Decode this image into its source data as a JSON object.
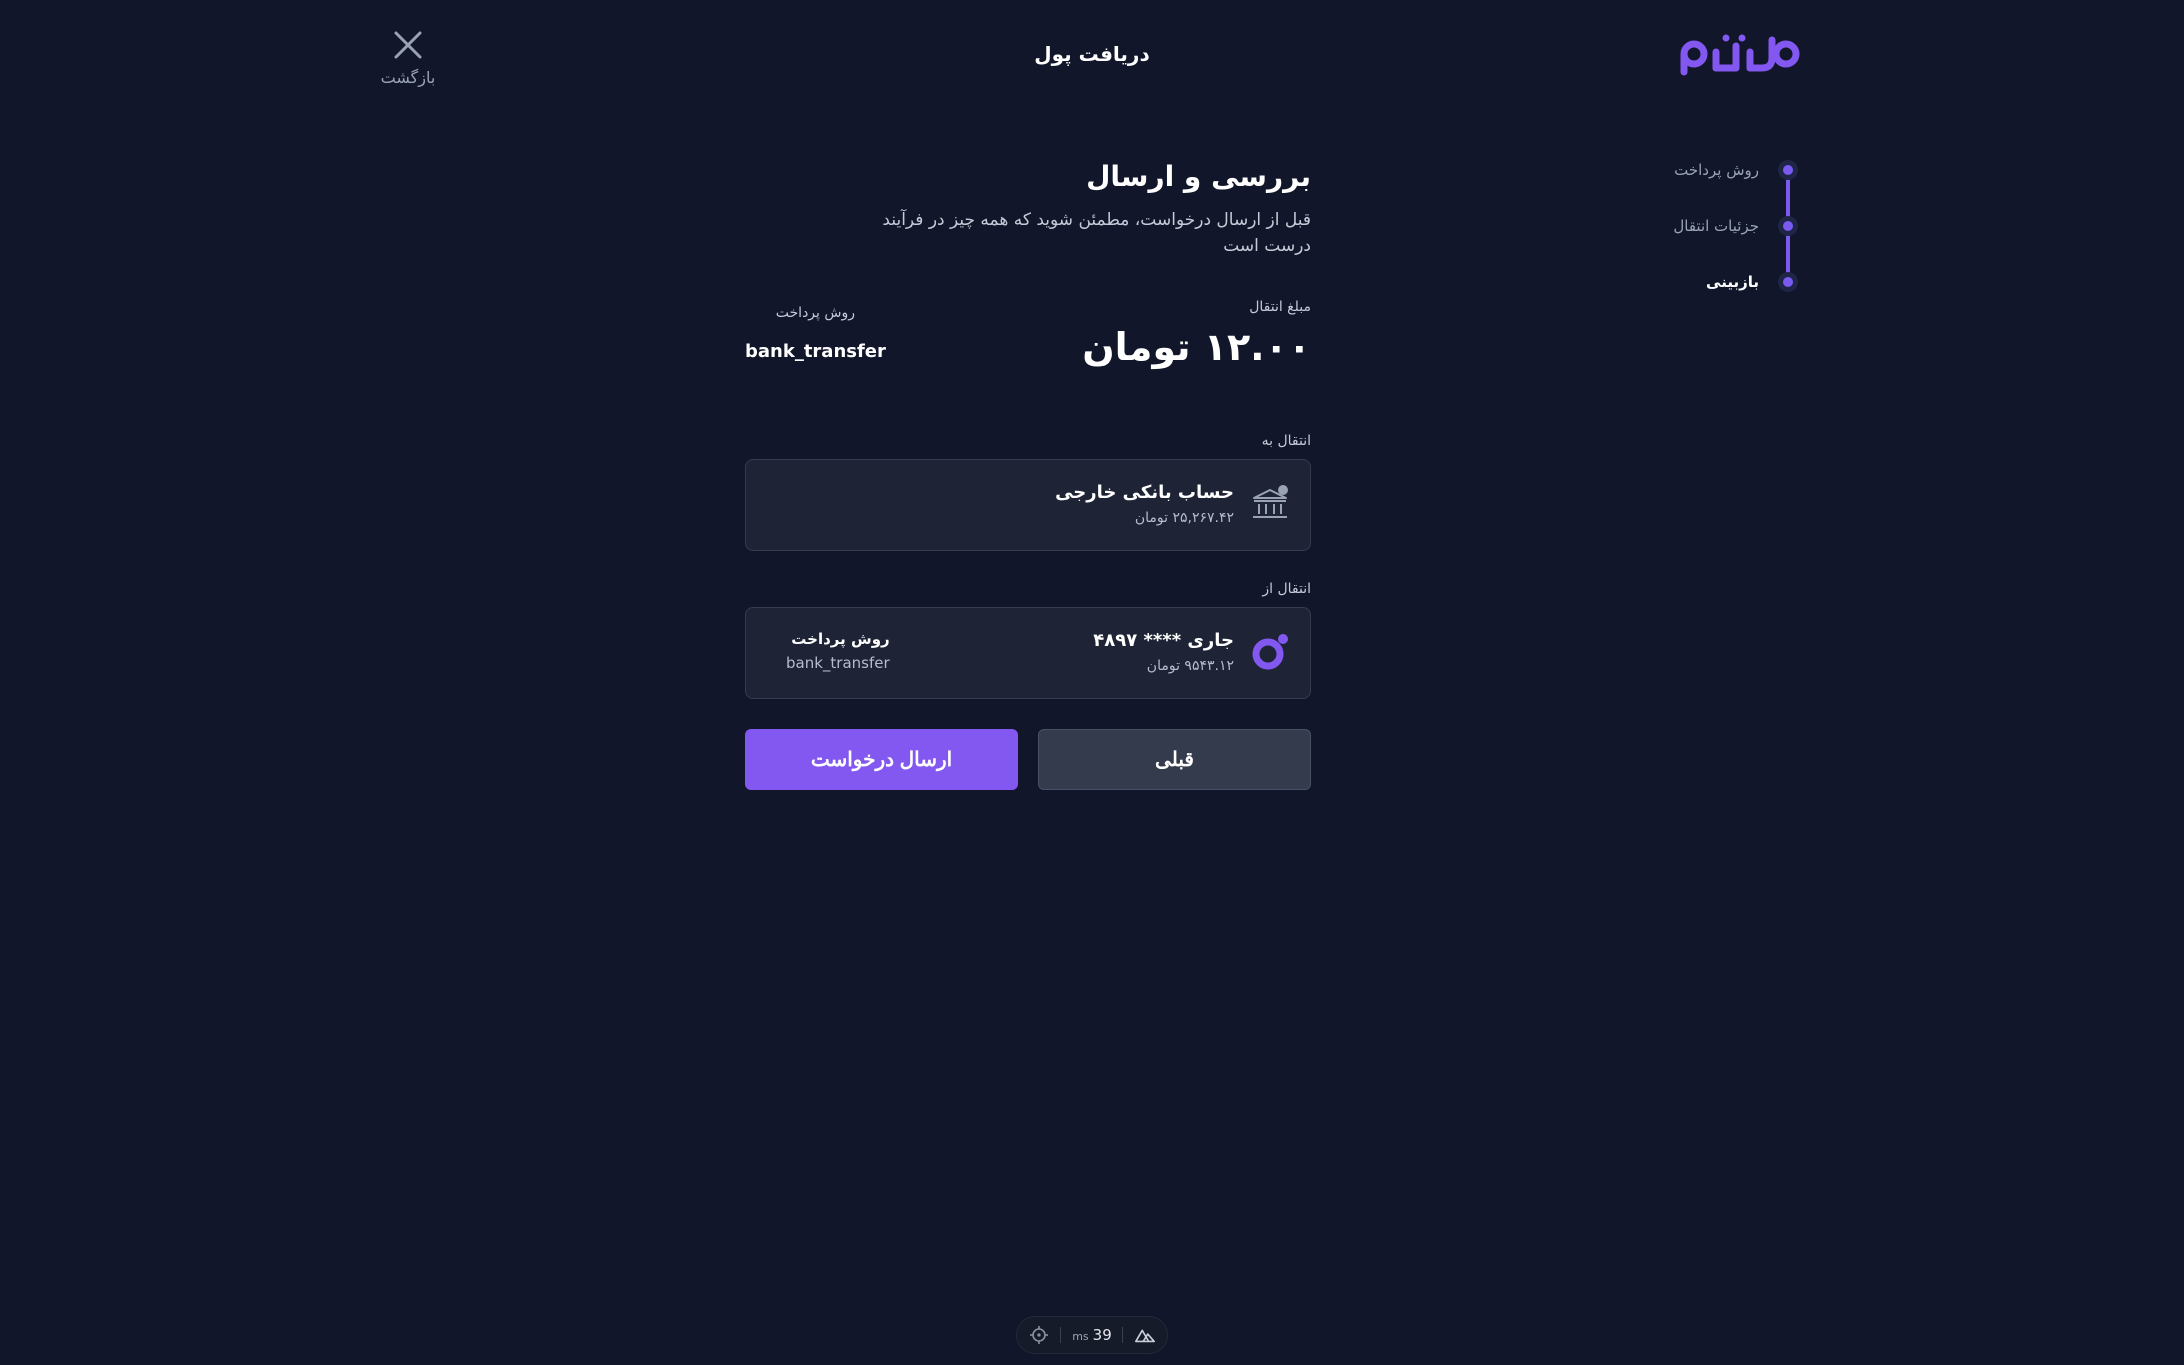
{
  "header": {
    "close_label": "بازگشت",
    "title": "دریافت پول"
  },
  "stepper": {
    "steps": [
      {
        "label": "روش پرداخت",
        "active": false
      },
      {
        "label": "جزئیات انتقال",
        "active": false
      },
      {
        "label": "بازبینی",
        "active": true
      }
    ]
  },
  "main": {
    "heading": "بررسی و ارسال",
    "subtitle": "قبل از ارسال درخواست، مطمئن شوید که همه چیز در فرآیند درست است",
    "amount": {
      "caption": "مبلغ انتقال",
      "value": "۱۲.۰۰ تومان"
    },
    "method": {
      "caption": "روش پرداخت",
      "value": "bank_transfer"
    },
    "to": {
      "section_label": "انتقال به",
      "name": "حساب بانکی خارجی",
      "balance": "۲۵,۲۶۷.۴۲ تومان",
      "icon": "bank-icon"
    },
    "from": {
      "section_label": "انتقال از",
      "name": "جاری **** ۴۸۹۷",
      "balance": "۹۵۴۳.۱۲ تومان",
      "icon": "wallet-ring-icon",
      "side_title": "روش پرداخت",
      "side_value": "bank_transfer"
    },
    "buttons": {
      "submit": "ارسال درخواست",
      "back": "قبلی"
    }
  },
  "devbar": {
    "ms_value": "39",
    "ms_unit": "ms"
  },
  "colors": {
    "accent": "#8358f0",
    "background": "#11162a",
    "card": "#1e2436"
  }
}
